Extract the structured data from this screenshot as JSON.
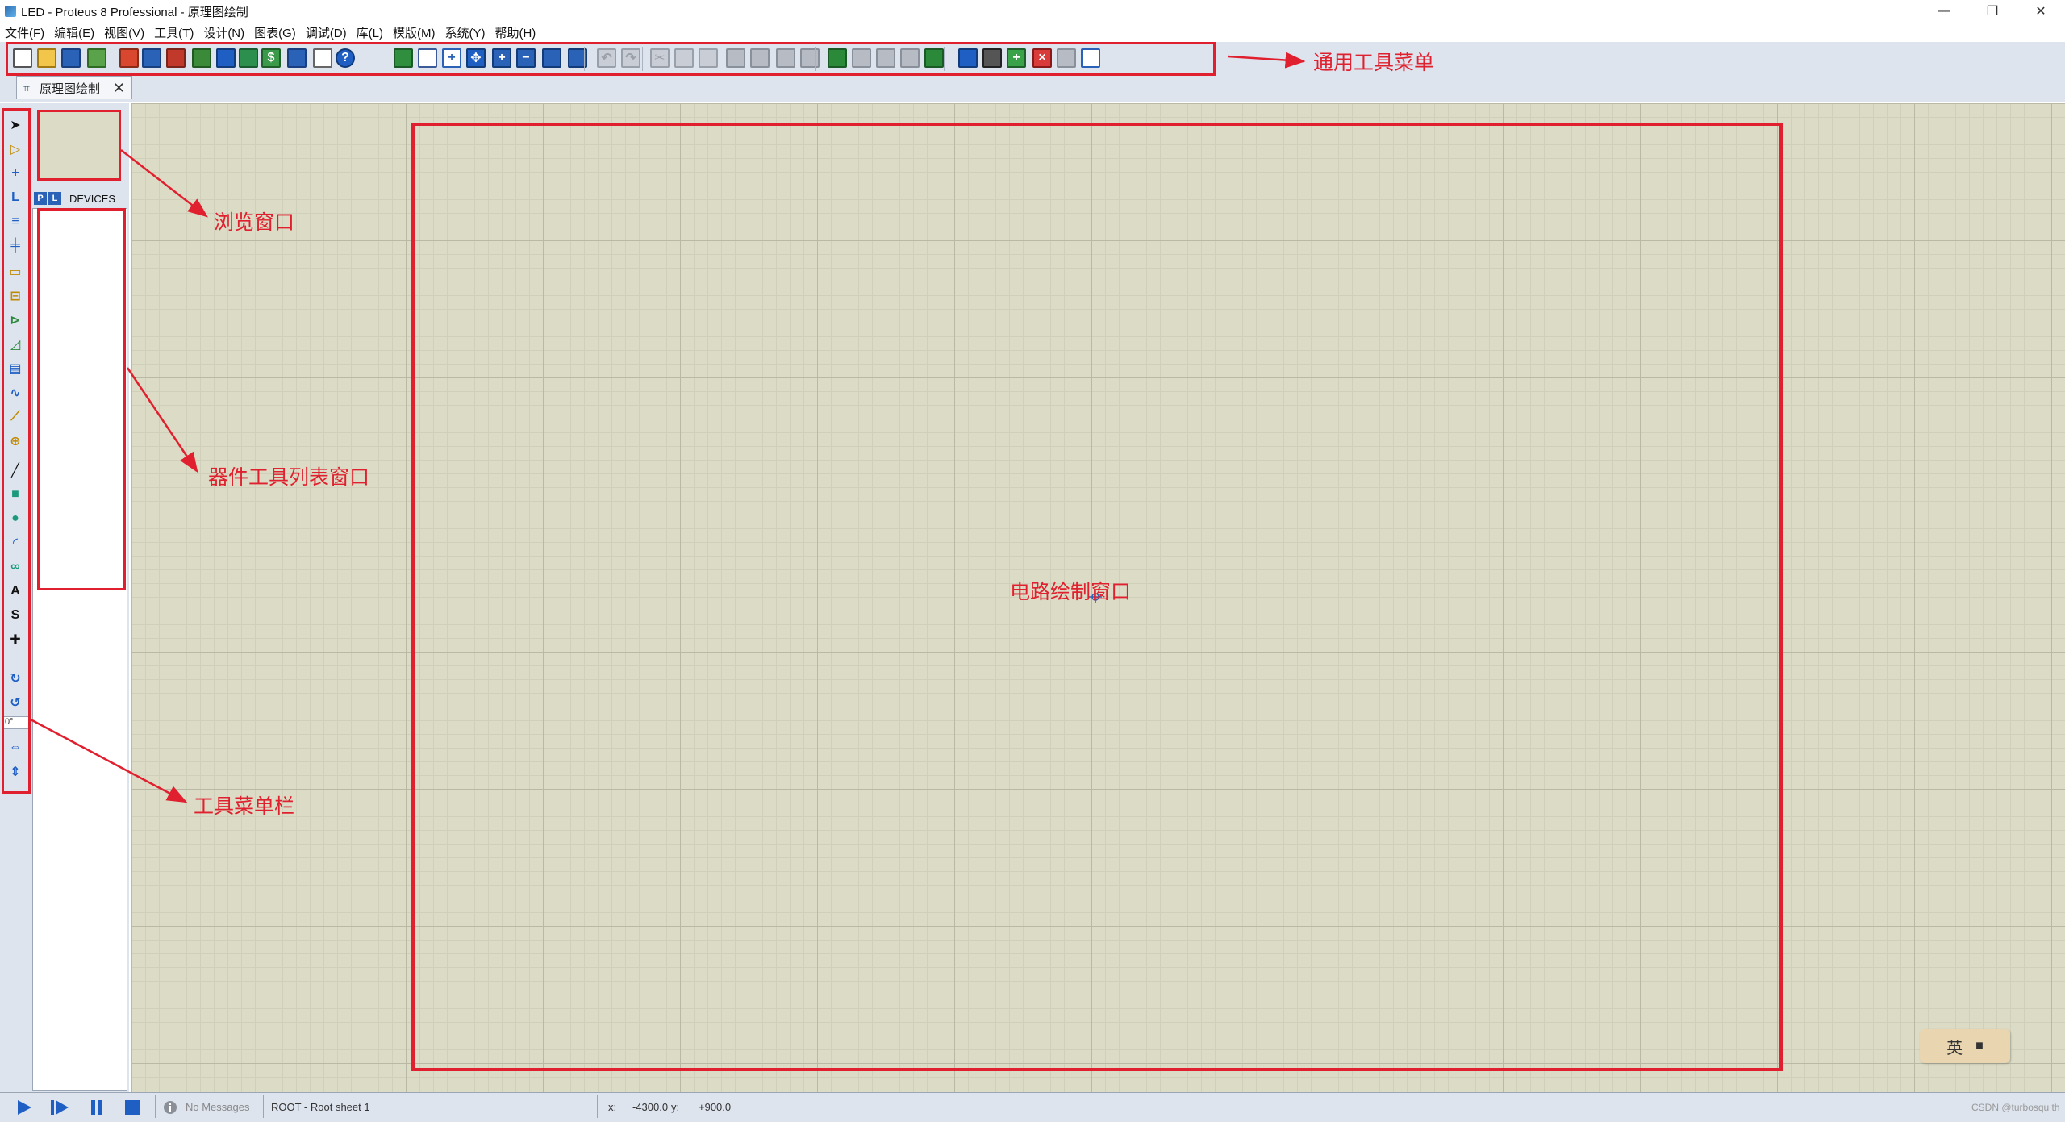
{
  "window": {
    "title": "LED - Proteus 8 Professional - 原理图绘制",
    "minimize": "—",
    "maximize": "❐",
    "close": "✕"
  },
  "menu": [
    "文件(F)",
    "编辑(E)",
    "视图(V)",
    "工具(T)",
    "设计(N)",
    "图表(G)",
    "调试(D)",
    "库(L)",
    "模版(M)",
    "系统(Y)",
    "帮助(H)"
  ],
  "toolbar": {
    "help_glyph": "?",
    "icons": [
      "new-file-icon",
      "open-folder-icon",
      "save-icon",
      "import-icon",
      "home-icon",
      "schematic-icon",
      "pcb-icon",
      "gerber-icon",
      "3d-view-icon",
      "bom-icon",
      "cost-icon",
      "design-explorer-icon",
      "notes-icon",
      "help-icon",
      "refresh-icon",
      "grid-icon",
      "origin-icon",
      "pan-icon",
      "zoom-in-icon",
      "zoom-out-icon",
      "zoom-all-icon",
      "zoom-area-icon",
      "undo-icon",
      "redo-icon",
      "cut-icon",
      "copy-icon",
      "paste-icon",
      "block-copy-icon",
      "block-move-icon",
      "block-rotate-icon",
      "block-delete-icon",
      "pick-device-icon",
      "make-device-icon",
      "packaging-icon",
      "decompose-icon",
      "wire-autorouter-icon",
      "search-icon",
      "property-tool-icon",
      "new-sheet-icon",
      "delete-sheet-icon",
      "goto-sheet-icon",
      "netlist-icon"
    ]
  },
  "tab": {
    "label": "原理图绘制",
    "close": "✕"
  },
  "left_tools": {
    "rotate_value": "0°",
    "icons": [
      "select-arrow-icon",
      "component-icon",
      "junction-icon",
      "wire-label-icon",
      "text-script-icon",
      "bus-icon",
      "subcircuit-icon",
      "terminal-icon",
      "device-pin-icon",
      "graph-icon",
      "tape-recorder-icon",
      "generator-icon",
      "voltage-probe-icon",
      "current-probe-icon",
      "line-icon",
      "box-icon",
      "circle-icon",
      "arc-icon",
      "path-icon",
      "text-icon",
      "symbol-icon",
      "marker-icon",
      "rotate-cw-icon",
      "rotate-ccw-icon",
      "flip-horizontal-icon",
      "flip-vertical-icon"
    ]
  },
  "devices": {
    "p_label": "P",
    "l_label": "L",
    "title": "DEVICES"
  },
  "annotations": {
    "toolbar": "通用工具菜单",
    "overview": "浏览窗口",
    "device_list": "器件工具列表窗口",
    "canvas": "电路绘制窗口",
    "toolstrip": "工具菜单栏"
  },
  "ime": {
    "label": "英"
  },
  "status": {
    "messages": "No Messages",
    "sheet": "ROOT - Root sheet 1",
    "x_label": "x:",
    "x_value": "-4300.0",
    "y_label": "y:",
    "y_value": "+900.0",
    "watermark": "CSDN @turbosqu th"
  },
  "colors": {
    "annotation": "#e0202e",
    "canvas_bg": "#dcdcc6",
    "ui_bg": "#dde4ee",
    "accent_blue": "#2a62b8"
  }
}
